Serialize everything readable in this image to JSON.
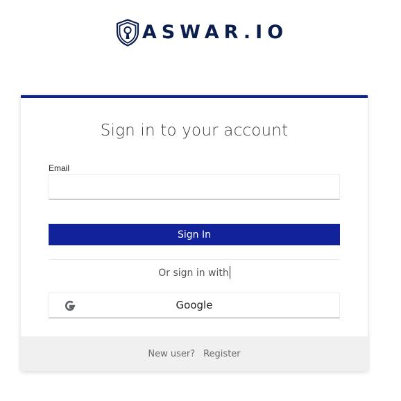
{
  "brand": {
    "name": "ASWAR.IO",
    "logo_icon": "keyhole-shield-icon",
    "color": "#0c1f4c"
  },
  "login": {
    "title": "Sign in to your account",
    "email_label": "Email",
    "email_value": "",
    "email_placeholder": "",
    "signin_label": "Sign In",
    "or_label": "Or sign in with",
    "providers": [
      {
        "label": "Google",
        "icon": "google-icon"
      }
    ],
    "footer_prompt": "New user?",
    "register_label": "Register"
  },
  "colors": {
    "accent": "#12229a",
    "top_bar": "#0e2296",
    "footer_bg": "#f0f0f0"
  }
}
